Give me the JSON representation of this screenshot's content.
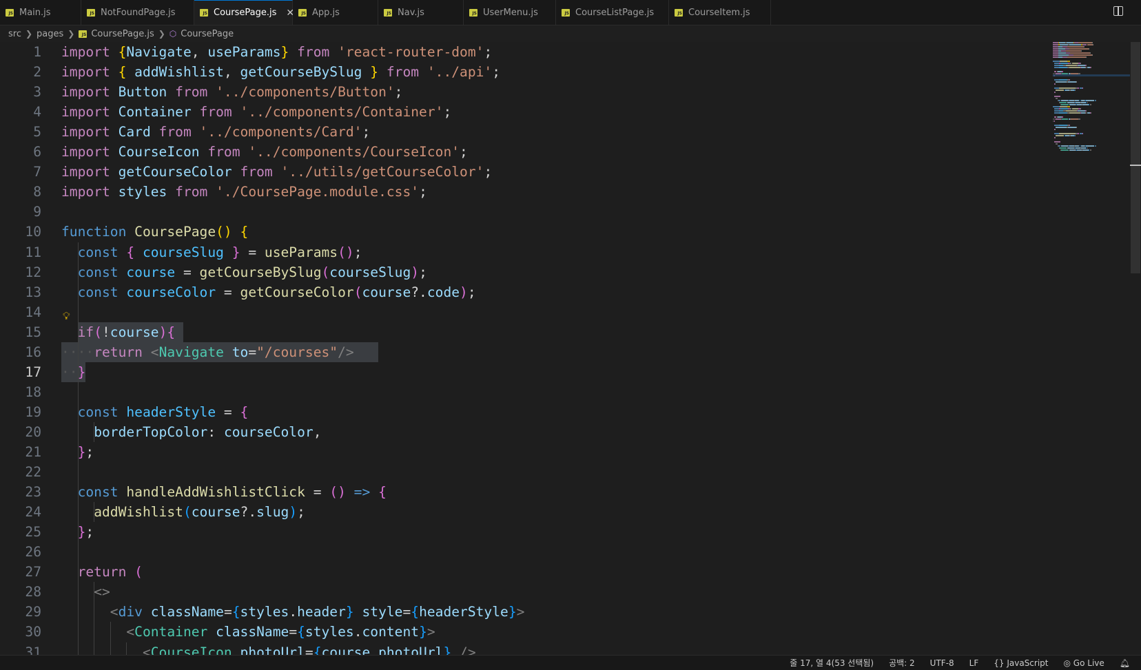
{
  "tabs": [
    {
      "label": "Main.js",
      "active": false
    },
    {
      "label": "NotFoundPage.js",
      "active": false
    },
    {
      "label": "CoursePage.js",
      "active": true
    },
    {
      "label": "App.js",
      "active": false
    },
    {
      "label": "Nav.js",
      "active": false
    },
    {
      "label": "UserMenu.js",
      "active": false
    },
    {
      "label": "CourseListPage.js",
      "active": false
    },
    {
      "label": "CourseItem.js",
      "active": false
    }
  ],
  "breadcrumb": {
    "items": [
      "src",
      "pages",
      "CoursePage.js",
      "CoursePage"
    ]
  },
  "editor": {
    "current_line": 17,
    "lines": [
      [
        [
          "kw",
          "import "
        ],
        [
          "b1",
          "{"
        ],
        [
          "vr",
          "Navigate"
        ],
        [
          "op",
          ", "
        ],
        [
          "vr",
          "useParams"
        ],
        [
          "b1",
          "}"
        ],
        [
          "kw",
          " from "
        ],
        [
          "sg",
          "'react-router-dom'"
        ],
        [
          "op",
          ";"
        ]
      ],
      [
        [
          "kw",
          "import "
        ],
        [
          "b1",
          "{ "
        ],
        [
          "vr",
          "addWishlist"
        ],
        [
          "op",
          ", "
        ],
        [
          "vr",
          "getCourseBySlug"
        ],
        [
          "b1",
          " }"
        ],
        [
          "kw",
          " from "
        ],
        [
          "sg",
          "'../api'"
        ],
        [
          "op",
          ";"
        ]
      ],
      [
        [
          "kw",
          "import "
        ],
        [
          "vr",
          "Button"
        ],
        [
          "kw",
          " from "
        ],
        [
          "sg",
          "'../components/Button'"
        ],
        [
          "op",
          ";"
        ]
      ],
      [
        [
          "kw",
          "import "
        ],
        [
          "vr",
          "Container"
        ],
        [
          "kw",
          " from "
        ],
        [
          "sg",
          "'../components/Container'"
        ],
        [
          "op",
          ";"
        ]
      ],
      [
        [
          "kw",
          "import "
        ],
        [
          "vr",
          "Card"
        ],
        [
          "kw",
          " from "
        ],
        [
          "sg",
          "'../components/Card'"
        ],
        [
          "op",
          ";"
        ]
      ],
      [
        [
          "kw",
          "import "
        ],
        [
          "vr",
          "CourseIcon"
        ],
        [
          "kw",
          " from "
        ],
        [
          "sg",
          "'../components/CourseIcon'"
        ],
        [
          "op",
          ";"
        ]
      ],
      [
        [
          "kw",
          "import "
        ],
        [
          "vr",
          "getCourseColor"
        ],
        [
          "kw",
          " from "
        ],
        [
          "sg",
          "'../utils/getCourseColor'"
        ],
        [
          "op",
          ";"
        ]
      ],
      [
        [
          "kw",
          "import "
        ],
        [
          "vr",
          "styles"
        ],
        [
          "kw",
          " from "
        ],
        [
          "sg",
          "'./CoursePage.module.css'"
        ],
        [
          "op",
          ";"
        ]
      ],
      [],
      [
        [
          "st",
          "function "
        ],
        [
          "fn",
          "CoursePage"
        ],
        [
          "b1",
          "() {"
        ]
      ],
      [
        [
          "op",
          "  "
        ],
        [
          "st",
          "const "
        ],
        [
          "b2",
          "{ "
        ],
        [
          "cs",
          "courseSlug"
        ],
        [
          "b2",
          " }"
        ],
        [
          "op",
          " = "
        ],
        [
          "fn",
          "useParams"
        ],
        [
          "b2",
          "()"
        ],
        [
          "op",
          ";"
        ]
      ],
      [
        [
          "op",
          "  "
        ],
        [
          "st",
          "const "
        ],
        [
          "cs",
          "course"
        ],
        [
          "op",
          " = "
        ],
        [
          "fn",
          "getCourseBySlug"
        ],
        [
          "b2",
          "("
        ],
        [
          "vr",
          "courseSlug"
        ],
        [
          "b2",
          ")"
        ],
        [
          "op",
          ";"
        ]
      ],
      [
        [
          "op",
          "  "
        ],
        [
          "st",
          "const "
        ],
        [
          "cs",
          "courseColor"
        ],
        [
          "op",
          " = "
        ],
        [
          "fn",
          "getCourseColor"
        ],
        [
          "b2",
          "("
        ],
        [
          "vr",
          "course"
        ],
        [
          "op",
          "?."
        ],
        [
          "vr",
          "code"
        ],
        [
          "b2",
          ")"
        ],
        [
          "op",
          ";"
        ]
      ],
      [],
      [
        [
          "op",
          "  "
        ],
        [
          "kw",
          "if"
        ],
        [
          "b2",
          "("
        ],
        [
          "op",
          "!"
        ],
        [
          "vr",
          "course"
        ],
        [
          "b2",
          ")"
        ],
        [
          "b2",
          "{"
        ],
        [
          "op",
          " "
        ]
      ],
      [
        [
          "ws",
          "····"
        ],
        [
          "kw",
          "return "
        ],
        [
          "pu",
          "<"
        ],
        [
          "tg",
          "Navigate"
        ],
        [
          "op",
          " "
        ],
        [
          "vr",
          "to"
        ],
        [
          "op",
          "="
        ],
        [
          "sg",
          "\"/courses\""
        ],
        [
          "pu",
          "/>"
        ]
      ],
      [
        [
          "ws",
          "··"
        ],
        [
          "b2",
          "}"
        ]
      ],
      [],
      [
        [
          "op",
          "  "
        ],
        [
          "st",
          "const "
        ],
        [
          "cs",
          "headerStyle"
        ],
        [
          "op",
          " = "
        ],
        [
          "b2",
          "{"
        ]
      ],
      [
        [
          "op",
          "    "
        ],
        [
          "vr",
          "borderTopColor"
        ],
        [
          "op",
          ": "
        ],
        [
          "vr",
          "courseColor"
        ],
        [
          "op",
          ","
        ]
      ],
      [
        [
          "op",
          "  "
        ],
        [
          "b2",
          "}"
        ],
        [
          "op",
          ";"
        ]
      ],
      [],
      [
        [
          "op",
          "  "
        ],
        [
          "st",
          "const "
        ],
        [
          "fn",
          "handleAddWishlistClick"
        ],
        [
          "op",
          " = "
        ],
        [
          "b2",
          "()"
        ],
        [
          "st",
          " => "
        ],
        [
          "b2",
          "{"
        ]
      ],
      [
        [
          "op",
          "    "
        ],
        [
          "fn",
          "addWishlist"
        ],
        [
          "b3",
          "("
        ],
        [
          "vr",
          "course"
        ],
        [
          "op",
          "?."
        ],
        [
          "vr",
          "slug"
        ],
        [
          "b3",
          ")"
        ],
        [
          "op",
          ";"
        ]
      ],
      [
        [
          "op",
          "  "
        ],
        [
          "b2",
          "}"
        ],
        [
          "op",
          ";"
        ]
      ],
      [],
      [
        [
          "op",
          "  "
        ],
        [
          "kw",
          "return "
        ],
        [
          "b2",
          "("
        ]
      ],
      [
        [
          "op",
          "    "
        ],
        [
          "pu",
          "<>"
        ]
      ],
      [
        [
          "op",
          "      "
        ],
        [
          "pu",
          "<"
        ],
        [
          "st",
          "div"
        ],
        [
          "op",
          " "
        ],
        [
          "vr",
          "className"
        ],
        [
          "op",
          "="
        ],
        [
          "b3",
          "{"
        ],
        [
          "vr",
          "styles"
        ],
        [
          "op",
          "."
        ],
        [
          "vr",
          "header"
        ],
        [
          "b3",
          "}"
        ],
        [
          "op",
          " "
        ],
        [
          "vr",
          "style"
        ],
        [
          "op",
          "="
        ],
        [
          "b3",
          "{"
        ],
        [
          "vr",
          "headerStyle"
        ],
        [
          "b3",
          "}"
        ],
        [
          "pu",
          ">"
        ]
      ],
      [
        [
          "op",
          "        "
        ],
        [
          "pu",
          "<"
        ],
        [
          "tg",
          "Container"
        ],
        [
          "op",
          " "
        ],
        [
          "vr",
          "className"
        ],
        [
          "op",
          "="
        ],
        [
          "b3",
          "{"
        ],
        [
          "vr",
          "styles"
        ],
        [
          "op",
          "."
        ],
        [
          "vr",
          "content"
        ],
        [
          "b3",
          "}"
        ],
        [
          "pu",
          ">"
        ]
      ],
      [
        [
          "op",
          "          "
        ],
        [
          "pu",
          "<"
        ],
        [
          "tg",
          "CourseIcon"
        ],
        [
          "op",
          " "
        ],
        [
          "vr",
          "photoUrl"
        ],
        [
          "op",
          "="
        ],
        [
          "b3",
          "{"
        ],
        [
          "vr",
          "course"
        ],
        [
          "op",
          "."
        ],
        [
          "vr",
          "photoUrl"
        ],
        [
          "b3",
          "}"
        ],
        [
          "op",
          " "
        ],
        [
          "pu",
          "/>"
        ]
      ]
    ]
  },
  "statusbar": {
    "position": "줄 17, 열 4(53 선택됨)",
    "indent": "공백: 2",
    "encoding": "UTF-8",
    "eol": "LF",
    "language": "JavaScript",
    "golive": "Go Live"
  },
  "colors": {
    "accent": "#0078d4",
    "editor_bg": "#1e1e1e",
    "keyword": "#c586c0",
    "string": "#ce9178"
  }
}
